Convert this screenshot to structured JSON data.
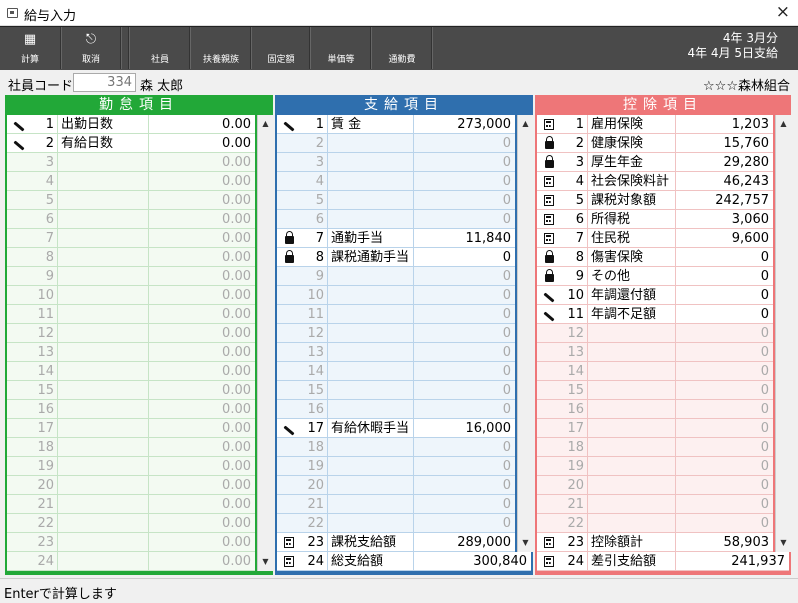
{
  "window": {
    "title": "給与入力",
    "close": "×"
  },
  "toolbar": {
    "buttons": [
      {
        "label": "計算",
        "icon": "calc-icon"
      },
      {
        "label": "取消",
        "icon": "exit-icon"
      },
      {
        "label": "社員"
      },
      {
        "label": "扶養親族"
      },
      {
        "label": "固定額"
      },
      {
        "label": "単価等"
      },
      {
        "label": "通勤費"
      }
    ],
    "period_line1": "4年 3月分",
    "period_line2": "4年 4月 5日支給"
  },
  "employee": {
    "code_label": "社員コード",
    "code": "334",
    "name": "森 太郎",
    "union": "☆☆☆森林組合"
  },
  "attendance": {
    "header": "勤怠項目",
    "rows": [
      {
        "no": "1",
        "name": "出勤日数",
        "value": "0.00",
        "icon": "pen",
        "active": true
      },
      {
        "no": "2",
        "name": "有給日数",
        "value": "0.00",
        "icon": "pen",
        "active": true
      },
      {
        "no": "3",
        "name": "",
        "value": "0.00"
      },
      {
        "no": "4",
        "name": "",
        "value": "0.00"
      },
      {
        "no": "5",
        "name": "",
        "value": "0.00"
      },
      {
        "no": "6",
        "name": "",
        "value": "0.00"
      },
      {
        "no": "7",
        "name": "",
        "value": "0.00"
      },
      {
        "no": "8",
        "name": "",
        "value": "0.00"
      },
      {
        "no": "9",
        "name": "",
        "value": "0.00"
      },
      {
        "no": "10",
        "name": "",
        "value": "0.00"
      },
      {
        "no": "11",
        "name": "",
        "value": "0.00"
      },
      {
        "no": "12",
        "name": "",
        "value": "0.00"
      },
      {
        "no": "13",
        "name": "",
        "value": "0.00"
      },
      {
        "no": "14",
        "name": "",
        "value": "0.00"
      },
      {
        "no": "15",
        "name": "",
        "value": "0.00"
      },
      {
        "no": "16",
        "name": "",
        "value": "0.00"
      },
      {
        "no": "17",
        "name": "",
        "value": "0.00"
      },
      {
        "no": "18",
        "name": "",
        "value": "0.00"
      },
      {
        "no": "19",
        "name": "",
        "value": "0.00"
      },
      {
        "no": "20",
        "name": "",
        "value": "0.00"
      },
      {
        "no": "21",
        "name": "",
        "value": "0.00"
      },
      {
        "no": "22",
        "name": "",
        "value": "0.00"
      },
      {
        "no": "23",
        "name": "",
        "value": "0.00"
      },
      {
        "no": "24",
        "name": "",
        "value": "0.00"
      }
    ]
  },
  "payment": {
    "header": "支給項目",
    "rows": [
      {
        "no": "1",
        "name": "賃 金",
        "value": "273,000",
        "icon": "pen",
        "active": true
      },
      {
        "no": "2",
        "name": "",
        "value": "0"
      },
      {
        "no": "3",
        "name": "",
        "value": "0"
      },
      {
        "no": "4",
        "name": "",
        "value": "0"
      },
      {
        "no": "5",
        "name": "",
        "value": "0"
      },
      {
        "no": "6",
        "name": "",
        "value": "0"
      },
      {
        "no": "7",
        "name": "通勤手当",
        "value": "11,840",
        "icon": "lock",
        "active": true
      },
      {
        "no": "8",
        "name": "課税通勤手当",
        "value": "0",
        "icon": "lock",
        "active": true
      },
      {
        "no": "9",
        "name": "",
        "value": "0"
      },
      {
        "no": "10",
        "name": "",
        "value": "0"
      },
      {
        "no": "11",
        "name": "",
        "value": "0"
      },
      {
        "no": "12",
        "name": "",
        "value": "0"
      },
      {
        "no": "13",
        "name": "",
        "value": "0"
      },
      {
        "no": "14",
        "name": "",
        "value": "0"
      },
      {
        "no": "15",
        "name": "",
        "value": "0"
      },
      {
        "no": "16",
        "name": "",
        "value": "0"
      },
      {
        "no": "17",
        "name": "有給休暇手当",
        "value": "16,000",
        "icon": "pen",
        "active": true
      },
      {
        "no": "18",
        "name": "",
        "value": "0"
      },
      {
        "no": "19",
        "name": "",
        "value": "0"
      },
      {
        "no": "20",
        "name": "",
        "value": "0"
      },
      {
        "no": "21",
        "name": "",
        "value": "0"
      },
      {
        "no": "22",
        "name": "",
        "value": "0"
      },
      {
        "no": "23",
        "name": "課税支給額",
        "value": "289,000",
        "icon": "calc",
        "active": true
      },
      {
        "no": "24",
        "name": "総支給額",
        "value": "300,840",
        "icon": "calc",
        "active": true
      }
    ]
  },
  "deduction": {
    "header": "控除項目",
    "rows": [
      {
        "no": "1",
        "name": "雇用保険",
        "value": "1,203",
        "icon": "calc",
        "active": true
      },
      {
        "no": "2",
        "name": "健康保険",
        "value": "15,760",
        "icon": "lock",
        "active": true
      },
      {
        "no": "3",
        "name": "厚生年金",
        "value": "29,280",
        "icon": "lock",
        "active": true
      },
      {
        "no": "4",
        "name": "社会保険料計",
        "value": "46,243",
        "icon": "calc",
        "active": true
      },
      {
        "no": "5",
        "name": "課税対象額",
        "value": "242,757",
        "icon": "calc",
        "active": true
      },
      {
        "no": "6",
        "name": "所得税",
        "value": "3,060",
        "icon": "calc",
        "active": true
      },
      {
        "no": "7",
        "name": "住民税",
        "value": "9,600",
        "icon": "calc",
        "active": true
      },
      {
        "no": "8",
        "name": "傷害保険",
        "value": "0",
        "icon": "lock",
        "active": true
      },
      {
        "no": "9",
        "name": "その他",
        "value": "0",
        "icon": "lock",
        "active": true
      },
      {
        "no": "10",
        "name": "年調還付額",
        "value": "0",
        "icon": "pen",
        "active": true
      },
      {
        "no": "11",
        "name": "年調不足額",
        "value": "0",
        "icon": "pen",
        "active": true
      },
      {
        "no": "12",
        "name": "",
        "value": "0"
      },
      {
        "no": "13",
        "name": "",
        "value": "0"
      },
      {
        "no": "14",
        "name": "",
        "value": "0"
      },
      {
        "no": "15",
        "name": "",
        "value": "0"
      },
      {
        "no": "16",
        "name": "",
        "value": "0"
      },
      {
        "no": "17",
        "name": "",
        "value": "0"
      },
      {
        "no": "18",
        "name": "",
        "value": "0"
      },
      {
        "no": "19",
        "name": "",
        "value": "0"
      },
      {
        "no": "20",
        "name": "",
        "value": "0"
      },
      {
        "no": "21",
        "name": "",
        "value": "0"
      },
      {
        "no": "22",
        "name": "",
        "value": "0"
      },
      {
        "no": "23",
        "name": "控除額計",
        "value": "58,903",
        "icon": "calc",
        "active": true
      },
      {
        "no": "24",
        "name": "差引支給額",
        "value": "241,937",
        "icon": "calc",
        "active": true
      }
    ]
  },
  "scroll": {
    "up": "▲",
    "down": "▼"
  },
  "status": {
    "text": "Enterで計算します"
  }
}
